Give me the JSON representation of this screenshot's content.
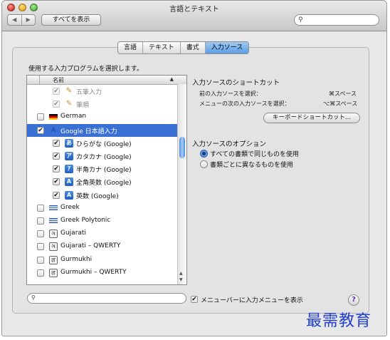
{
  "window": {
    "title": "言語とテキスト",
    "show_all_label": "すべてを表示",
    "nav_back": "◀",
    "nav_forward": "▶",
    "search_placeholder": ""
  },
  "tabs": [
    {
      "label": "言語",
      "active": false
    },
    {
      "label": "テキスト",
      "active": false
    },
    {
      "label": "書式",
      "active": false
    },
    {
      "label": "入力ソース",
      "active": true
    }
  ],
  "instructions": "使用する入力プログラムを選択します。",
  "list": {
    "header_label": "名前",
    "sort_indicator": "▲",
    "rows": [
      {
        "label": "五筆入力",
        "checked": true,
        "disabled": true,
        "icon": "pen-icon",
        "glyph": "✎"
      },
      {
        "label": "筆順",
        "checked": true,
        "disabled": true,
        "icon": "pen-icon",
        "glyph": "✎"
      },
      {
        "label": "German",
        "checked": false,
        "icon": "german-flag-icon",
        "glyph": ""
      },
      {
        "label": "Google 日本語入力",
        "checked": true,
        "selected": true,
        "icon": "google-input-icon",
        "glyph": "A"
      },
      {
        "label": "ひらがな (Google)",
        "checked": true,
        "icon": "hiragana-icon",
        "glyph": "あ"
      },
      {
        "label": "カタカナ (Google)",
        "checked": true,
        "icon": "katakana-icon",
        "glyph": "ア"
      },
      {
        "label": "半角カナ (Google)",
        "checked": true,
        "icon": "halfwidth-kana-icon",
        "glyph": "ｱ"
      },
      {
        "label": "全角英数 (Google)",
        "checked": true,
        "icon": "fullwidth-alnum-icon",
        "glyph": "A"
      },
      {
        "label": "英数 (Google)",
        "checked": true,
        "icon": "alphanumeric-icon",
        "glyph": "A"
      },
      {
        "label": "Greek",
        "checked": false,
        "icon": "greek-flag-icon",
        "glyph": ""
      },
      {
        "label": "Greek Polytonic",
        "checked": false,
        "icon": "greek-flag-icon",
        "glyph": ""
      },
      {
        "label": "Gujarati",
        "checked": false,
        "icon": "gujarati-script-icon",
        "glyph": "ગ"
      },
      {
        "label": "Gujarati – QWERTY",
        "checked": false,
        "icon": "gujarati-script-icon",
        "glyph": "ગ"
      },
      {
        "label": "Gurmukhi",
        "checked": false,
        "icon": "gurmukhi-script-icon",
        "glyph": "ਗ"
      },
      {
        "label": "Gurmukhi – QWERTY",
        "checked": false,
        "icon": "gurmukhi-script-icon",
        "glyph": "ਗ"
      }
    ]
  },
  "shortcuts": {
    "title": "入力ソースのショートカット",
    "items": [
      {
        "label": "前の入力ソースを選択：",
        "keys": "⌘スペース"
      },
      {
        "label": "メニューの次の入力ソースを選択：",
        "keys": "⌥⌘スペース"
      }
    ],
    "button_label": "キーボードショートカット..."
  },
  "options": {
    "title": "入力ソースのオプション",
    "radios": [
      {
        "label": "すべての書類で同じものを使用",
        "selected": true
      },
      {
        "label": "書類ごとに異なるものを使用",
        "selected": false
      }
    ]
  },
  "bottom": {
    "search_placeholder": "",
    "menu_checkbox_label": "メニューバーに入力メニューを表示",
    "menu_checked": true,
    "help_label": "?"
  },
  "watermark": "最需教育"
}
